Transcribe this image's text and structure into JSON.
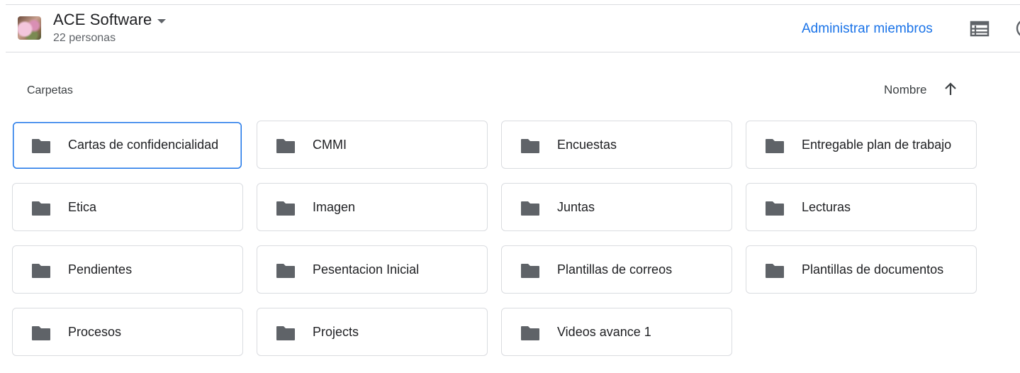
{
  "header": {
    "drive_name": "ACE Software",
    "members_count": "22 personas",
    "manage_members_label": "Administrar miembros"
  },
  "section": {
    "title": "Carpetas",
    "sort_label": "Nombre"
  },
  "folders": [
    {
      "name": "Cartas de confidencialidad",
      "selected": true
    },
    {
      "name": "CMMI"
    },
    {
      "name": "Encuestas"
    },
    {
      "name": "Entregable plan de trabajo"
    },
    {
      "name": "Etica"
    },
    {
      "name": "Imagen"
    },
    {
      "name": "Juntas"
    },
    {
      "name": "Lecturas"
    },
    {
      "name": "Pendientes"
    },
    {
      "name": "Pesentacion Inicial"
    },
    {
      "name": "Plantillas de correos"
    },
    {
      "name": "Plantillas de documentos"
    },
    {
      "name": "Procesos"
    },
    {
      "name": "Projects"
    },
    {
      "name": "Videos avance 1"
    }
  ],
  "colors": {
    "accent": "#1a73e8",
    "folder_icon": "#5f6368",
    "border": "#dadce0"
  },
  "icons": {
    "dropdown": "arrow-drop-down-icon",
    "list_view": "list-view-icon",
    "info": "info-icon",
    "sort": "arrow-upward-icon",
    "folder": "folder-icon"
  }
}
